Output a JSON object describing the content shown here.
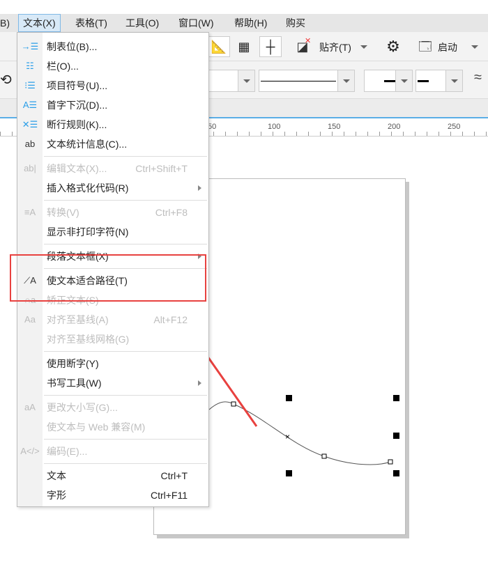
{
  "menubar": [
    {
      "label": "B)"
    },
    {
      "label": "文本(X)",
      "active": true
    },
    {
      "label": "表格(T)"
    },
    {
      "label": "工具(O)"
    },
    {
      "label": "窗口(W)"
    },
    {
      "label": "帮助(H)"
    },
    {
      "label": "购买"
    }
  ],
  "toolbar": {
    "snap_label": "贴齐(T)",
    "launch_label": "启动"
  },
  "ruler": [
    "50",
    "100",
    "150",
    "200",
    "250"
  ],
  "menu": [
    {
      "label": "制表位(B)...",
      "icon": "tab-stops-icon",
      "glyph": "→☰"
    },
    {
      "label": "栏(O)...",
      "icon": "columns-icon",
      "glyph": "☷"
    },
    {
      "label": "项目符号(U)...",
      "icon": "bullets-icon",
      "glyph": "⁝☰"
    },
    {
      "label": "首字下沉(D)...",
      "icon": "drop-cap-icon",
      "glyph": "A☰"
    },
    {
      "label": "断行规则(K)...",
      "icon": "line-break-rules-icon",
      "glyph": "✕☰"
    },
    {
      "label": "文本统计信息(C)...",
      "icon": "text-statistics-icon",
      "glyph": "ab"
    },
    {
      "sep": true
    },
    {
      "label": "编辑文本(X)...",
      "shortcut": "Ctrl+Shift+T",
      "disabled": true,
      "icon": "edit-text-icon",
      "glyph": "ab|"
    },
    {
      "label": "插入格式化代码(R)",
      "submenu": true
    },
    {
      "sep": true
    },
    {
      "label": "转换(V)",
      "shortcut": "Ctrl+F8",
      "disabled": true,
      "icon": "convert-icon",
      "glyph": "≡A"
    },
    {
      "label": "显示非打印字符(N)"
    },
    {
      "sep": true
    },
    {
      "label": "段落文本框(X)",
      "submenu": true
    },
    {
      "sep": true
    },
    {
      "label": "使文本适合路径(T)",
      "icon": "fit-text-to-path-icon",
      "glyph": "⟋A"
    },
    {
      "label": "矫正文本(S)",
      "disabled": true,
      "icon": "straighten-text-icon",
      "glyph": "∩a"
    },
    {
      "label": "对齐至基线(A)",
      "shortcut": "Alt+F12",
      "disabled": true,
      "icon": "align-baseline-icon",
      "glyph": "Aa"
    },
    {
      "label": "对齐至基线网格(G)",
      "disabled": true
    },
    {
      "sep": true
    },
    {
      "label": "使用断字(Y)"
    },
    {
      "label": "书写工具(W)",
      "submenu": true
    },
    {
      "sep": true
    },
    {
      "label": "更改大小写(G)...",
      "disabled": true,
      "icon": "change-case-icon",
      "glyph": "aA"
    },
    {
      "label": "使文本与 Web 兼容(M)",
      "disabled": true
    },
    {
      "sep": true
    },
    {
      "label": "编码(E)...",
      "disabled": true,
      "icon": "encoding-icon",
      "glyph": "A</>"
    },
    {
      "sep": true
    },
    {
      "label": "文本",
      "shortcut": "Ctrl+T"
    },
    {
      "label": "字形",
      "shortcut": "Ctrl+F11"
    }
  ],
  "colors": {
    "highlight": "#e8413f",
    "accent": "#2a9ee8"
  }
}
